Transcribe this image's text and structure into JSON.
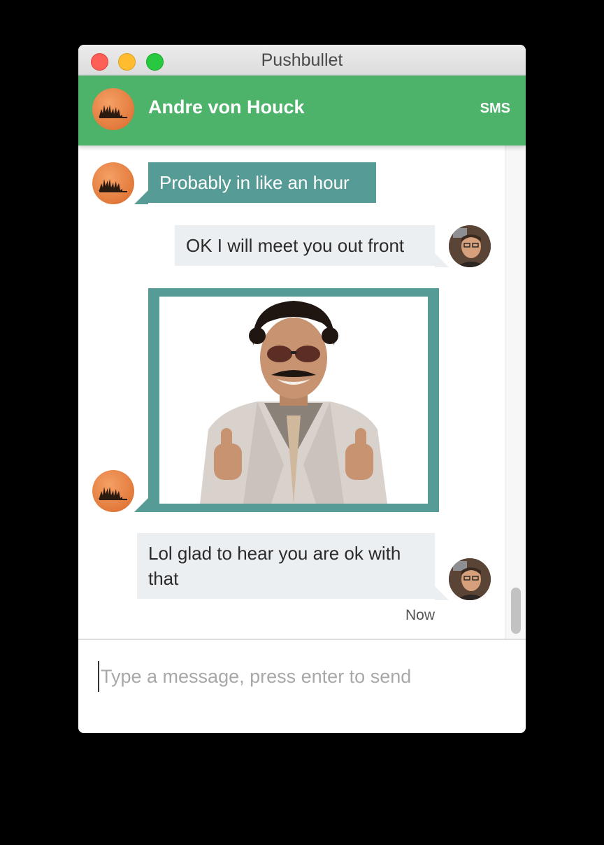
{
  "window": {
    "title": "Pushbullet"
  },
  "header": {
    "contact_name": "Andre von Houck",
    "mode_label": "SMS"
  },
  "messages": [
    {
      "direction": "incoming",
      "type": "text",
      "text": "Probably in like an hour"
    },
    {
      "direction": "outgoing",
      "type": "text",
      "text": "OK I will meet you out front"
    },
    {
      "direction": "incoming",
      "type": "image",
      "image_subject": "man-in-suit-thumbs-up"
    },
    {
      "direction": "outgoing",
      "type": "text",
      "text": "Lol glad to hear you are ok with that"
    }
  ],
  "timestamp": "Now",
  "composer": {
    "placeholder": "Type a message, press enter to send",
    "value": ""
  },
  "scrollbar": {
    "position": 1.0
  },
  "colors": {
    "header_green": "#4db26a",
    "incoming_bubble": "#579b96",
    "outgoing_bubble": "#eceff1",
    "contact_avatar": "#e27a3c"
  }
}
